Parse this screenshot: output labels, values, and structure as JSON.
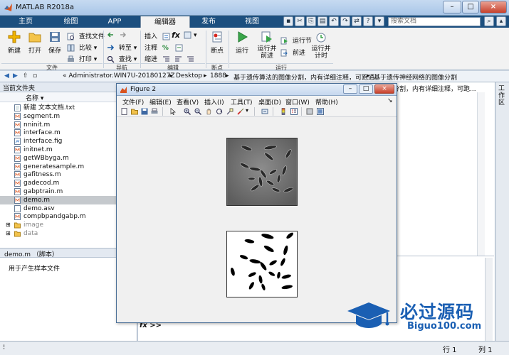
{
  "window": {
    "title": "MATLAB R2018a",
    "minimize": "–",
    "maximize": "□",
    "close": "×"
  },
  "tabs": [
    {
      "label": "主页"
    },
    {
      "label": "绘图"
    },
    {
      "label": "APP"
    },
    {
      "label": "编辑器",
      "active": true
    },
    {
      "label": "发布"
    },
    {
      "label": "视图"
    }
  ],
  "search": {
    "placeholder": "搜索文档"
  },
  "ribbon": {
    "file": {
      "new": "新建",
      "open": "打开",
      "save": "保存",
      "find_files": "查找文件",
      "compare": "比较",
      "print": "打印",
      "group": "文件"
    },
    "navigate": {
      "goto": "转至",
      "find": "查找",
      "group": "导航"
    },
    "edit": {
      "insert": "插入",
      "comment": "注释",
      "indent": "缩进",
      "fx": "fx",
      "group": "编辑"
    },
    "breakpoints": {
      "label": "断点",
      "group": "断点"
    },
    "run": {
      "run": "运行",
      "run_advance": "运行并前进",
      "run_section": "运行节",
      "advance": "前进",
      "run_time": "运行并计时",
      "group": "运行"
    }
  },
  "address": {
    "path": [
      "« Administrator.WIN7U-20180127Z",
      "Desktop",
      "1888",
      "基于遗传算法的图像分割，内有详细注释，可跑通",
      "基于遗传神经网络的图像分割"
    ]
  },
  "file_browser": {
    "title": "当前文件夹",
    "column": "名称 ▾",
    "files": [
      {
        "name": "新建 文本文档.txt",
        "type": "txt"
      },
      {
        "name": "segment.m",
        "type": "m"
      },
      {
        "name": "nninit.m",
        "type": "m"
      },
      {
        "name": "interface.m",
        "type": "m"
      },
      {
        "name": "interface.fig",
        "type": "fig"
      },
      {
        "name": "initnet.m",
        "type": "m"
      },
      {
        "name": "getWBbyga.m",
        "type": "m"
      },
      {
        "name": "generatesample.m",
        "type": "m"
      },
      {
        "name": "gafitness.m",
        "type": "m"
      },
      {
        "name": "gadecod.m",
        "type": "m"
      },
      {
        "name": "gabptrain.m",
        "type": "m"
      },
      {
        "name": "demo.m",
        "type": "m",
        "selected": true
      },
      {
        "name": "demo.asv",
        "type": "asv"
      },
      {
        "name": "compbpandgabp.m",
        "type": "m"
      },
      {
        "name": "image",
        "type": "folder"
      },
      {
        "name": "data",
        "type": "folder"
      }
    ],
    "details_title": "demo.m （脚本）",
    "details_text": "用于产生样本文件"
  },
  "editor_overlap_text": "分割，内有详细注释，可跑...",
  "right_sidebar_label": "工作区",
  "command": {
    "prompt": "fx >>"
  },
  "status": {
    "row": "行 1",
    "col": "列 1"
  },
  "figure": {
    "title": "Figure 2",
    "menu": [
      "文件(F)",
      "编辑(E)",
      "查看(V)",
      "插入(I)",
      "工具(T)",
      "桌面(D)",
      "窗口(W)",
      "帮助(H)"
    ]
  },
  "watermark": {
    "brand": "必过源码",
    "url": "Biguo100.com"
  },
  "colors": {
    "tabbar": "#1c4f7f",
    "accent": "#1e5fa8",
    "watermark": "#1a5fb3"
  }
}
